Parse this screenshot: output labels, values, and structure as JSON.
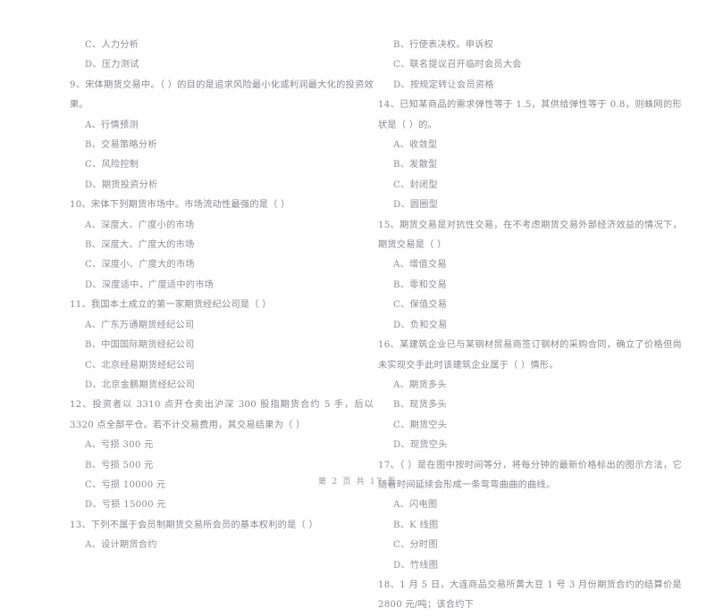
{
  "document": {
    "type": "scanned-exam-paper",
    "language": "zh-CN"
  },
  "footer": {
    "text": "第 2 页 共 17 页"
  },
  "columns": {
    "left": [
      {
        "id": "q8-tail",
        "number": "",
        "stem": "",
        "options": [
          "C、人力分析",
          "D、压力测试"
        ]
      },
      {
        "id": "q9",
        "number": "9",
        "stem": "9、宋体期货交易中。（      ）的目的是追求风险最小化或利润最大化的投资效果。",
        "options": [
          "A、行情预测",
          "B、交易策略分析",
          "C、风险控制",
          "D、期货投资分析"
        ]
      },
      {
        "id": "q10",
        "number": "10",
        "stem": "10、宋体下列期货市场中。市场流动性最强的是（      ）",
        "options": [
          "A、深度大、广度小的市场",
          "B、深度大、广度大的市场",
          "C、深度小、广度大的市场",
          "D、深度适中，广度适中的市场"
        ]
      },
      {
        "id": "q11",
        "number": "11",
        "stem": "11、我国本土成立的第一家期货经纪公司是（      ）",
        "options": [
          "A、广东万通期货经纪公司",
          "B、中国国际期货经纪公司",
          "C、北京经易期货经纪公司",
          "D、北京金鹏期货经纪公司"
        ]
      },
      {
        "id": "q12",
        "number": "12",
        "stem": "12、投资者以 3310 点开仓卖出沪深 300 股指期货合约 5 手，后以 3320 点全部平仓。若不计交易费用，其交易结果为（      ）",
        "options": [
          "A、亏损 300 元",
          "B、亏损 500 元",
          "C、亏损 10000 元",
          "D、亏损 15000 元"
        ]
      },
      {
        "id": "q13",
        "number": "13",
        "stem": "13、下列不属于会员制期货交易所会员的基本权利的是（      ）",
        "options": [
          "A、设计期货合约"
        ]
      }
    ],
    "right": [
      {
        "id": "q13-cont",
        "number": "",
        "stem": "",
        "options": [
          "B、行使表决权。申诉权",
          "C、联名提议召开临时会员大会",
          "D、按规定转让会员资格"
        ]
      },
      {
        "id": "q14",
        "number": "14",
        "stem": "14、已知某商品的需求弹性等于 1.5，其供给弹性等于 0.8，则蛛网的形状是（      ）的。",
        "options": [
          "A、收敛型",
          "B、发散型",
          "C、封闭型",
          "D、圆圈型"
        ]
      },
      {
        "id": "q15",
        "number": "15",
        "stem": "15、期货交易是对抗性交易，在不考虑期货交易外部经济效益的情况下，期货交易是（      ）",
        "options": [
          "A、增值交易",
          "B、零和交易",
          "C、保值交易",
          "D、负和交易"
        ]
      },
      {
        "id": "q16",
        "number": "16",
        "stem": "16、某建筑企业已与某钢材贸易商签订钢材的采购合同，确立了价格但尚未实现交手此时该建筑企业属于（      ）情形。",
        "options": [
          "A、期货多头",
          "B、现货多头",
          "C、期货空头",
          "D、现货空头"
        ]
      },
      {
        "id": "q17",
        "number": "17",
        "stem": "17、（      ）是在图中按时间等分，将每分钟的最新价格标出的图示方法，它随着时间延续会形成一条弯弯曲曲的曲线。",
        "options": [
          "A、闪电图",
          "B、K 线图",
          "C、分时图",
          "D、竹线图"
        ]
      },
      {
        "id": "q18",
        "number": "18",
        "stem": "18、1 月 5 日，大连商品交易所黄大豆 1 号 3 月份期货合约的结算价是 2800 元/吨；该合约下",
        "options": []
      }
    ]
  }
}
